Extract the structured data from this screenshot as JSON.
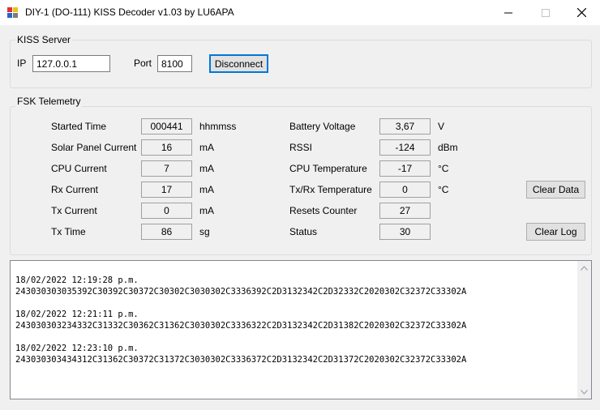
{
  "window": {
    "title": "DIY-1 (DO-111) KISS Decoder v1.03 by LU6APA",
    "icon": "app-icon",
    "controls": {
      "minimize": "minimize-icon",
      "maximize": "maximize-icon",
      "close": "close-icon"
    }
  },
  "kiss_server": {
    "legend": "KISS Server",
    "ip_label": "IP",
    "ip_value": "127.0.0.1",
    "port_label": "Port",
    "port_value": "8100",
    "disconnect_label": "Disconnect"
  },
  "fsk": {
    "legend": "FSK Telemetry",
    "left": [
      {
        "label": "Started Time",
        "value": "000441",
        "unit": "hhmmss"
      },
      {
        "label": "Solar Panel Current",
        "value": "16",
        "unit": "mA"
      },
      {
        "label": "CPU Current",
        "value": "7",
        "unit": "mA"
      },
      {
        "label": "Rx Current",
        "value": "17",
        "unit": "mA"
      },
      {
        "label": "Tx Current",
        "value": "0",
        "unit": "mA"
      },
      {
        "label": "Tx Time",
        "value": "86",
        "unit": "sg"
      }
    ],
    "right": [
      {
        "label": "Battery Voltage",
        "value": "3,67",
        "unit": "V"
      },
      {
        "label": "RSSI",
        "value": "-124",
        "unit": "dBm"
      },
      {
        "label": "CPU Temperature",
        "value": "-17",
        "unit": "°C"
      },
      {
        "label": "Tx/Rx Temperature",
        "value": "0",
        "unit": "°C"
      },
      {
        "label": "Resets Counter",
        "value": "27",
        "unit": ""
      },
      {
        "label": "Status",
        "value": "30",
        "unit": ""
      }
    ],
    "clear_data_label": "Clear Data",
    "clear_log_label": "Clear Log"
  },
  "log": {
    "entries": [
      {
        "timestamp": "18/02/2022 12:19:28 p.m.",
        "hex": "243030303035392C30392C30372C30302C3030302C3336392C2D3132342C2D32332C2020302C32372C33302A"
      },
      {
        "timestamp": "18/02/2022 12:21:11 p.m.",
        "hex": "243030303234332C31332C30362C31362C3030302C3336322C2D3132342C2D31382C2020302C32372C33302A"
      },
      {
        "timestamp": "18/02/2022 12:23:10 p.m.",
        "hex": "243030303434312C31362C30372C31372C3030302C3336372C2D3132342C2D31372C2020302C32372C33302A"
      }
    ]
  },
  "colors": {
    "focus_border": "#0078d7",
    "window_bg": "#f0f0f0"
  }
}
